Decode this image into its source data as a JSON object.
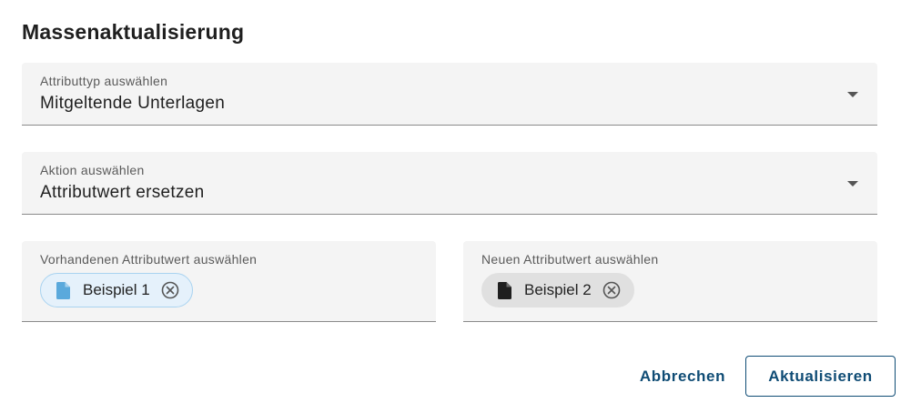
{
  "dialog": {
    "title": "Massenaktualisierung"
  },
  "attribute_type": {
    "label": "Attributtyp auswählen",
    "value": "Mitgeltende Unterlagen"
  },
  "action": {
    "label": "Aktion auswählen",
    "value": "Attributwert ersetzen"
  },
  "existing_value": {
    "label": "Vorhandenen Attributwert auswählen",
    "chip": {
      "text": "Beispiel 1",
      "icon": "document-icon",
      "remove_icon": "remove-circle-icon",
      "color": "#5aa9dc"
    }
  },
  "new_value": {
    "label": "Neuen Attributwert auswählen",
    "chip": {
      "text": "Beispiel 2",
      "icon": "document-icon",
      "remove_icon": "remove-circle-icon",
      "color": "#1f1f1f"
    }
  },
  "actions": {
    "cancel_label": "Abbrechen",
    "submit_label": "Aktualisieren",
    "accent_color": "#0f4c75"
  }
}
